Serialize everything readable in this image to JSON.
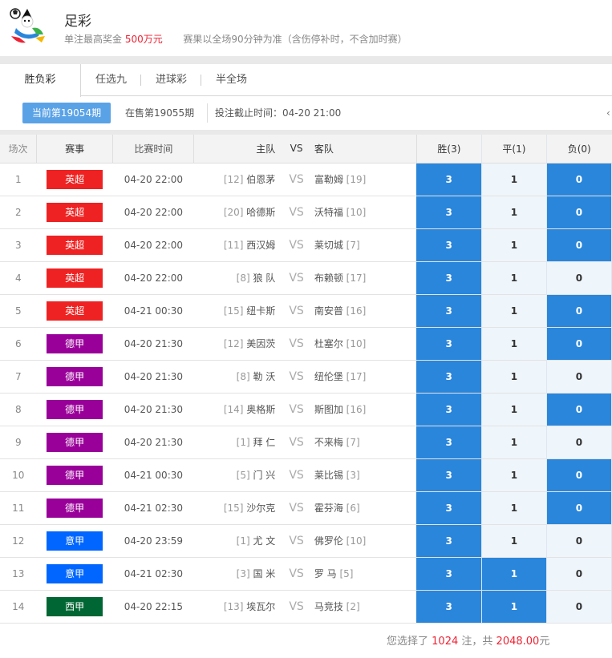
{
  "header": {
    "title": "足彩",
    "max_prize_label": "单注最高奖金",
    "max_prize_value": "500万元",
    "rule_note": "赛果以全场90分钟为准（含伤停补时，不含加时赛）"
  },
  "tabs": [
    {
      "label": "胜负彩",
      "active": true
    },
    {
      "label": "任选九",
      "active": false
    },
    {
      "label": "进球彩",
      "active": false
    },
    {
      "label": "半全场",
      "active": false
    }
  ],
  "issue": {
    "current_label": "当前第19054期",
    "next_label": "在售第19055期",
    "deadline_label": "投注截止时间：04-20 21:00",
    "edge_glyph": "‹"
  },
  "table": {
    "headers": {
      "no": "场次",
      "league": "赛事",
      "time": "比赛时间",
      "home": "主队",
      "vs": "VS",
      "away": "客队",
      "win": "胜(3)",
      "draw": "平(1)",
      "lose": "负(0)"
    },
    "odds_values": {
      "win": "3",
      "draw": "1",
      "lose": "0"
    },
    "rows": [
      {
        "no": "1",
        "league": "英超",
        "league_color": "#ee2222",
        "time": "04-20 22:00",
        "home_rank": "[12]",
        "home": "伯恩茅",
        "vs": "VS",
        "away": "富勒姆",
        "away_rank": "[19]",
        "win": true,
        "draw": false,
        "lose": true
      },
      {
        "no": "2",
        "league": "英超",
        "league_color": "#ee2222",
        "time": "04-20 22:00",
        "home_rank": "[20]",
        "home": "哈德斯",
        "vs": "VS",
        "away": "沃特福",
        "away_rank": "[10]",
        "win": true,
        "draw": false,
        "lose": true
      },
      {
        "no": "3",
        "league": "英超",
        "league_color": "#ee2222",
        "time": "04-20 22:00",
        "home_rank": "[11]",
        "home": "西汉姆",
        "vs": "VS",
        "away": "莱切城",
        "away_rank": "[7]",
        "win": true,
        "draw": false,
        "lose": true
      },
      {
        "no": "4",
        "league": "英超",
        "league_color": "#ee2222",
        "time": "04-20 22:00",
        "home_rank": "[8]",
        "home": "狼 队",
        "vs": "VS",
        "away": "布赖顿",
        "away_rank": "[17]",
        "win": true,
        "draw": false,
        "lose": false
      },
      {
        "no": "5",
        "league": "英超",
        "league_color": "#ee2222",
        "time": "04-21 00:30",
        "home_rank": "[15]",
        "home": "纽卡斯",
        "vs": "VS",
        "away": "南安普",
        "away_rank": "[16]",
        "win": true,
        "draw": false,
        "lose": true
      },
      {
        "no": "6",
        "league": "德甲",
        "league_color": "#990099",
        "time": "04-20 21:30",
        "home_rank": "[12]",
        "home": "美因茨",
        "vs": "VS",
        "away": "杜塞尔",
        "away_rank": "[10]",
        "win": true,
        "draw": false,
        "lose": true
      },
      {
        "no": "7",
        "league": "德甲",
        "league_color": "#990099",
        "time": "04-20 21:30",
        "home_rank": "[8]",
        "home": "勒 沃",
        "vs": "VS",
        "away": "纽伦堡",
        "away_rank": "[17]",
        "win": true,
        "draw": false,
        "lose": false
      },
      {
        "no": "8",
        "league": "德甲",
        "league_color": "#990099",
        "time": "04-20 21:30",
        "home_rank": "[14]",
        "home": "奥格斯",
        "vs": "VS",
        "away": "斯图加",
        "away_rank": "[16]",
        "win": true,
        "draw": false,
        "lose": true
      },
      {
        "no": "9",
        "league": "德甲",
        "league_color": "#990099",
        "time": "04-20 21:30",
        "home_rank": "[1]",
        "home": "拜 仁",
        "vs": "VS",
        "away": "不来梅",
        "away_rank": "[7]",
        "win": true,
        "draw": false,
        "lose": false
      },
      {
        "no": "10",
        "league": "德甲",
        "league_color": "#990099",
        "time": "04-21 00:30",
        "home_rank": "[5]",
        "home": "门 兴",
        "vs": "VS",
        "away": "莱比锡",
        "away_rank": "[3]",
        "win": true,
        "draw": false,
        "lose": true
      },
      {
        "no": "11",
        "league": "德甲",
        "league_color": "#990099",
        "time": "04-21 02:30",
        "home_rank": "[15]",
        "home": "沙尔克",
        "vs": "VS",
        "away": "霍芬海",
        "away_rank": "[6]",
        "win": true,
        "draw": false,
        "lose": true
      },
      {
        "no": "12",
        "league": "意甲",
        "league_color": "#0066ff",
        "time": "04-20 23:59",
        "home_rank": "[1]",
        "home": "尤 文",
        "vs": "VS",
        "away": "佛罗伦",
        "away_rank": "[10]",
        "win": true,
        "draw": false,
        "lose": false
      },
      {
        "no": "13",
        "league": "意甲",
        "league_color": "#0066ff",
        "time": "04-21 02:30",
        "home_rank": "[3]",
        "home": "国 米",
        "vs": "VS",
        "away": "罗 马",
        "away_rank": "[5]",
        "win": true,
        "draw": true,
        "lose": false
      },
      {
        "no": "14",
        "league": "西甲",
        "league_color": "#006633",
        "time": "04-20 22:15",
        "home_rank": "[13]",
        "home": "埃瓦尔",
        "vs": "VS",
        "away": "马竞技",
        "away_rank": "[2]",
        "win": true,
        "draw": true,
        "lose": false
      }
    ]
  },
  "footer": {
    "prefix": "您选择了",
    "count": "1024",
    "mid": "注，共",
    "amount": "2048.00",
    "suffix": "元"
  },
  "colors": {
    "selected": "#2a86db",
    "unselected": "#eef5fb",
    "accent_red": "#ee2233"
  }
}
